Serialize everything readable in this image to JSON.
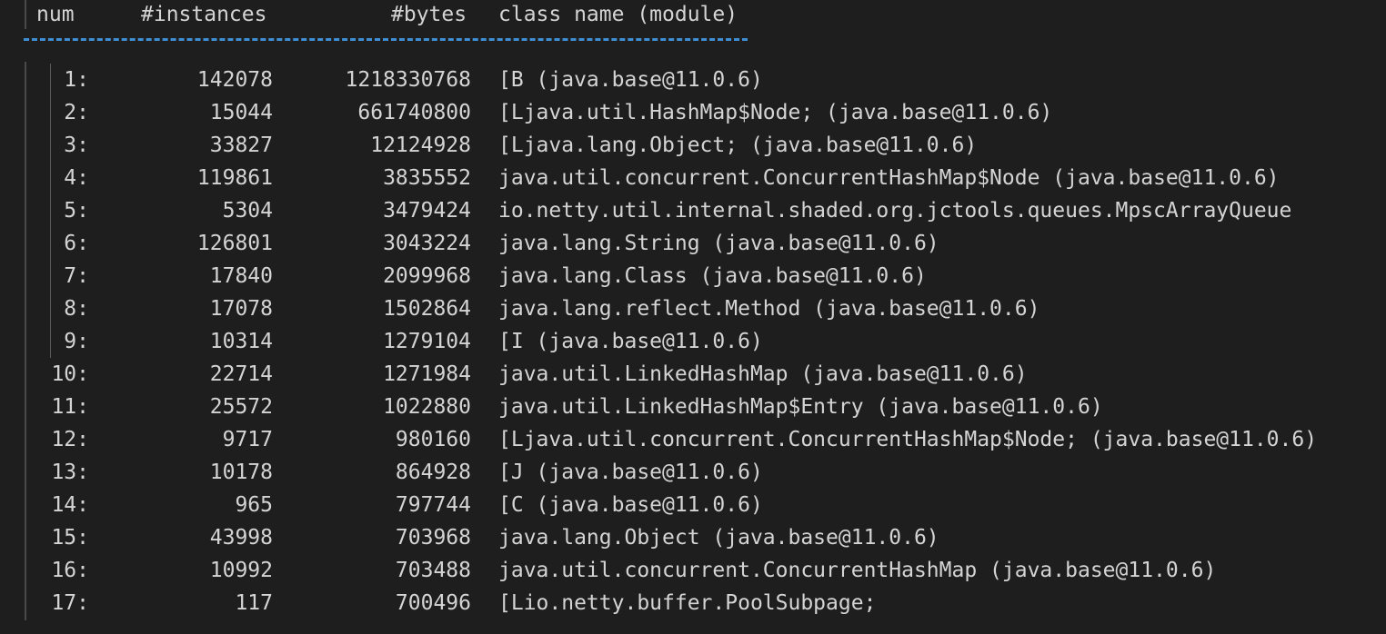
{
  "header": {
    "num": "num",
    "instances": "#instances",
    "bytes": "#bytes",
    "class_name": "class name (module)"
  },
  "rows": [
    {
      "num": "1:",
      "instances": "142078",
      "bytes": "1218330768",
      "class_name": "[B (java.base@11.0.6)"
    },
    {
      "num": "2:",
      "instances": "15044",
      "bytes": "661740800",
      "class_name": "[Ljava.util.HashMap$Node; (java.base@11.0.6)"
    },
    {
      "num": "3:",
      "instances": "33827",
      "bytes": "12124928",
      "class_name": "[Ljava.lang.Object; (java.base@11.0.6)"
    },
    {
      "num": "4:",
      "instances": "119861",
      "bytes": "3835552",
      "class_name": "java.util.concurrent.ConcurrentHashMap$Node (java.base@11.0.6)"
    },
    {
      "num": "5:",
      "instances": "5304",
      "bytes": "3479424",
      "class_name": "io.netty.util.internal.shaded.org.jctools.queues.MpscArrayQueue"
    },
    {
      "num": "6:",
      "instances": "126801",
      "bytes": "3043224",
      "class_name": "java.lang.String (java.base@11.0.6)"
    },
    {
      "num": "7:",
      "instances": "17840",
      "bytes": "2099968",
      "class_name": "java.lang.Class (java.base@11.0.6)"
    },
    {
      "num": "8:",
      "instances": "17078",
      "bytes": "1502864",
      "class_name": "java.lang.reflect.Method (java.base@11.0.6)"
    },
    {
      "num": "9:",
      "instances": "10314",
      "bytes": "1279104",
      "class_name": "[I (java.base@11.0.6)"
    },
    {
      "num": "10:",
      "instances": "22714",
      "bytes": "1271984",
      "class_name": "java.util.LinkedHashMap (java.base@11.0.6)"
    },
    {
      "num": "11:",
      "instances": "25572",
      "bytes": "1022880",
      "class_name": "java.util.LinkedHashMap$Entry (java.base@11.0.6)"
    },
    {
      "num": "12:",
      "instances": "9717",
      "bytes": "980160",
      "class_name": "[Ljava.util.concurrent.ConcurrentHashMap$Node; (java.base@11.0.6)"
    },
    {
      "num": "13:",
      "instances": "10178",
      "bytes": "864928",
      "class_name": "[J (java.base@11.0.6)"
    },
    {
      "num": "14:",
      "instances": "965",
      "bytes": "797744",
      "class_name": "[C (java.base@11.0.6)"
    },
    {
      "num": "15:",
      "instances": "43998",
      "bytes": "703968",
      "class_name": "java.lang.Object (java.base@11.0.6)"
    },
    {
      "num": "16:",
      "instances": "10992",
      "bytes": "703488",
      "class_name": "java.util.concurrent.ConcurrentHashMap (java.base@11.0.6)"
    },
    {
      "num": "17:",
      "instances": "117",
      "bytes": "700496",
      "class_name": "[Lio.netty.buffer.PoolSubpage;"
    }
  ]
}
